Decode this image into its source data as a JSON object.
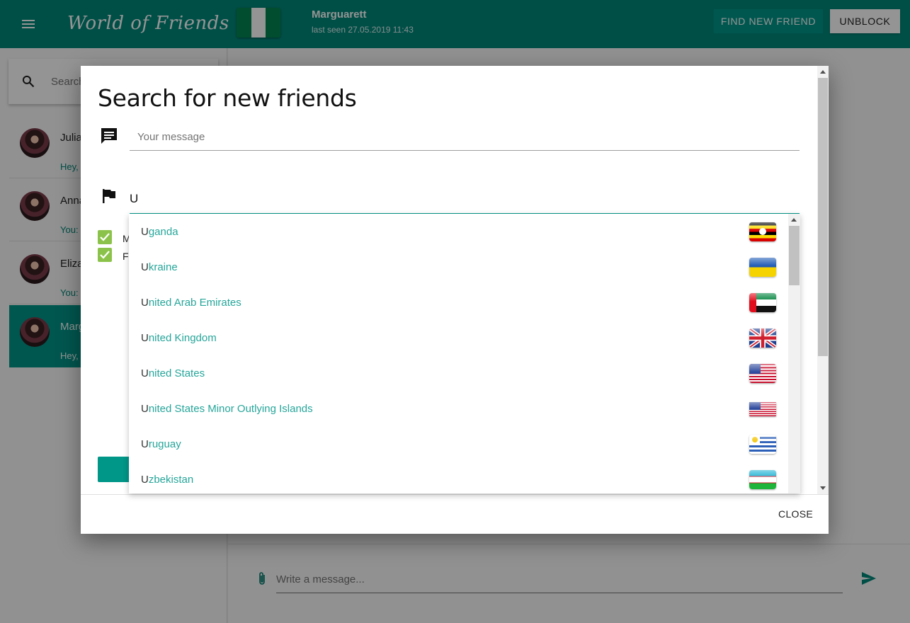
{
  "app": {
    "title": "World of Friends",
    "menu_icon": "menu-icon"
  },
  "header": {
    "contact_name": "Marguarett",
    "last_seen": "last seen 27.05.2019 11:43",
    "find_button": "FIND NEW FRIEND",
    "unblock_button": "UNBLOCK",
    "flag": "nigeria-flag"
  },
  "sidebar": {
    "search_placeholder": "Search...",
    "chats": [
      {
        "name": "Julia",
        "preview": "Hey, "
      },
      {
        "name": "Anna",
        "preview": "You: "
      },
      {
        "name": "Eliza",
        "preview": "You: "
      },
      {
        "name": "Marguarett",
        "preview": "Hey, "
      }
    ]
  },
  "composer": {
    "placeholder": "Write a message...",
    "attach_icon": "paperclip-icon",
    "send_icon": "send-icon"
  },
  "dialog": {
    "title": "Search for new friends",
    "message_placeholder": "Your message",
    "country_value": "U",
    "checkboxes": [
      {
        "label": "Male",
        "checked": true
      },
      {
        "label": "Female",
        "checked": true
      }
    ],
    "close_button": "CLOSE"
  },
  "dropdown": {
    "items": [
      {
        "match": "U",
        "rest": "ganda",
        "flag": "uganda"
      },
      {
        "match": "U",
        "rest": "kraine",
        "flag": "ukraine"
      },
      {
        "match": "U",
        "rest": "nited Arab Emirates",
        "flag": "uae"
      },
      {
        "match": "U",
        "rest": "nited Kingdom",
        "flag": "uk"
      },
      {
        "match": "U",
        "rest": "nited States",
        "flag": "usa"
      },
      {
        "match": "U",
        "rest": "nited States Minor Outlying Islands",
        "flag": "usa"
      },
      {
        "match": "U",
        "rest": "ruguay",
        "flag": "uruguay"
      },
      {
        "match": "U",
        "rest": "zbekistan",
        "flag": "uzbekistan"
      }
    ]
  },
  "colors": {
    "primary": "#00897b",
    "accent": "#009688",
    "checkbox": "#8bc34a",
    "suggestion_text": "#26a69a"
  }
}
